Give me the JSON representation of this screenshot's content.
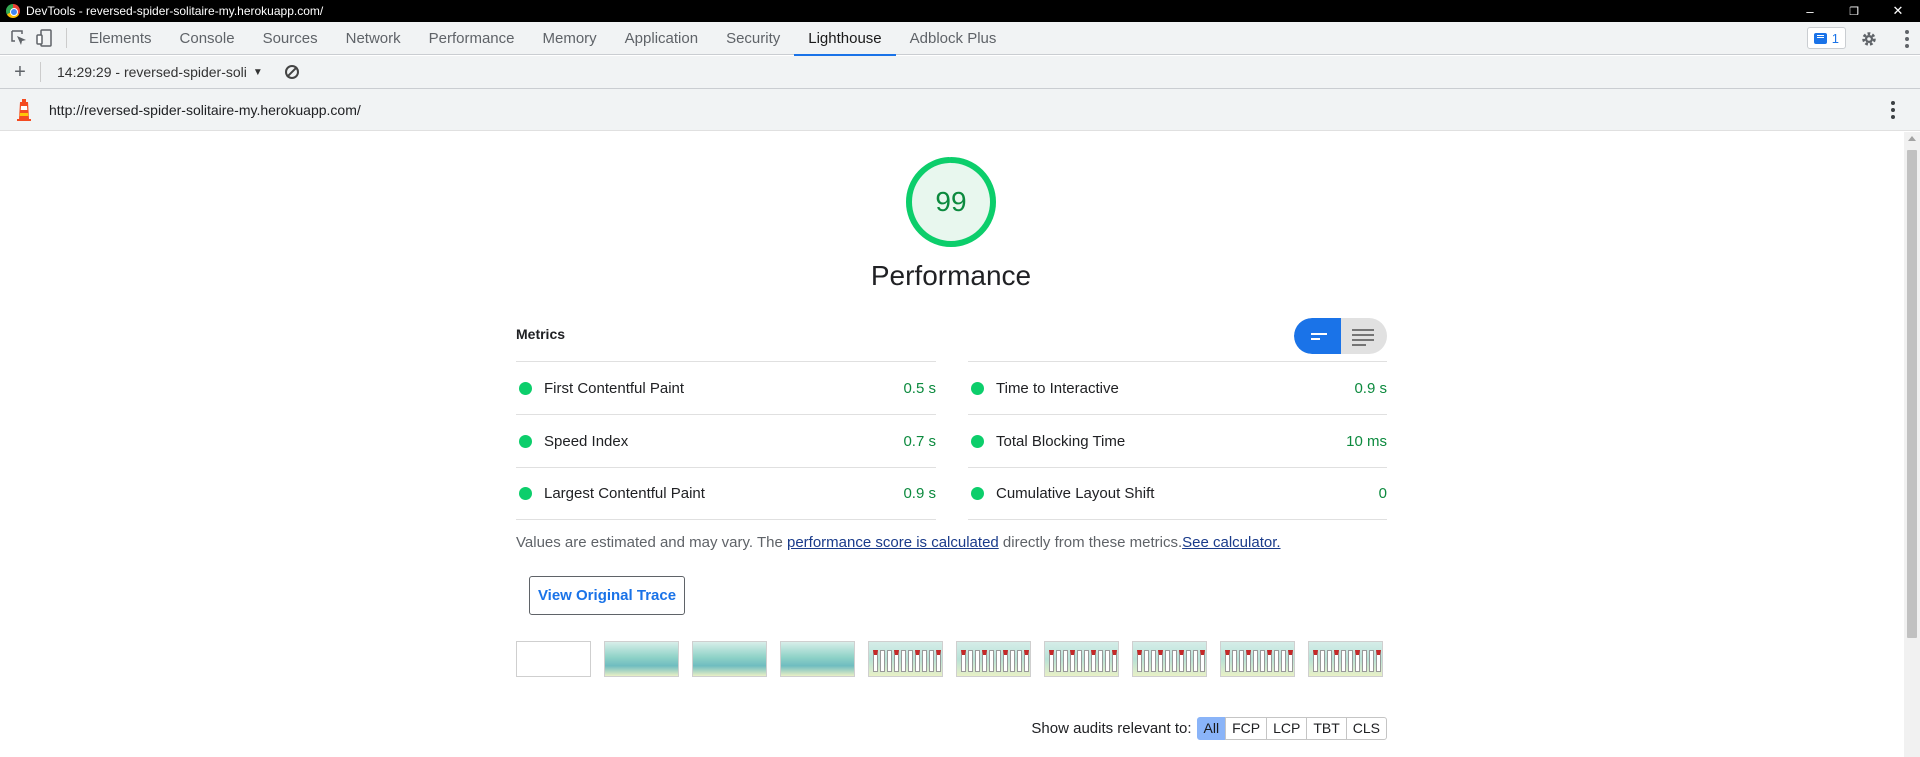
{
  "window": {
    "title": "DevTools - reversed-spider-solitaire-my.herokuapp.com/",
    "controls": {
      "minimize": "–",
      "restore": "❐",
      "close": "✕"
    }
  },
  "devtools": {
    "tabs": [
      "Elements",
      "Console",
      "Sources",
      "Network",
      "Performance",
      "Memory",
      "Application",
      "Security",
      "Lighthouse",
      "Adblock Plus"
    ],
    "active_tab": "Lighthouse",
    "issues_count": "1"
  },
  "toolbar": {
    "add_label": "+",
    "report_select": "14:29:29 - reversed-spider-soli",
    "caret": "▼"
  },
  "urlbar": {
    "url": "http://reversed-spider-solitaire-my.herokuapp.com/"
  },
  "report": {
    "score": "99",
    "score_fraction": 0.99,
    "category": "Performance",
    "metrics_heading": "Metrics",
    "metrics_left": [
      {
        "name": "First Contentful Paint",
        "value": "0.5 s"
      },
      {
        "name": "Speed Index",
        "value": "0.7 s"
      },
      {
        "name": "Largest Contentful Paint",
        "value": "0.9 s"
      }
    ],
    "metrics_right": [
      {
        "name": "Time to Interactive",
        "value": "0.9 s"
      },
      {
        "name": "Total Blocking Time",
        "value": "10 ms"
      },
      {
        "name": "Cumulative Layout Shift",
        "value": "0"
      }
    ],
    "note_prefix": "Values are estimated and may vary. The",
    "note_link1": "performance score is calculated",
    "note_mid": "directly from these metrics.",
    "note_link2": "See calculator.",
    "trace_button": "View Original Trace",
    "filmstrip": [
      "blank",
      "grad",
      "grad",
      "grad",
      "game",
      "game",
      "game",
      "game",
      "game",
      "game"
    ],
    "filter_label": "Show audits relevant to:",
    "filters": [
      "All",
      "FCP",
      "LCP",
      "TBT",
      "CLS"
    ],
    "active_filter": "All"
  },
  "colors": {
    "pass": "#0cce6b",
    "pass_text": "#0c8a3e",
    "accent": "#1a73e8"
  }
}
